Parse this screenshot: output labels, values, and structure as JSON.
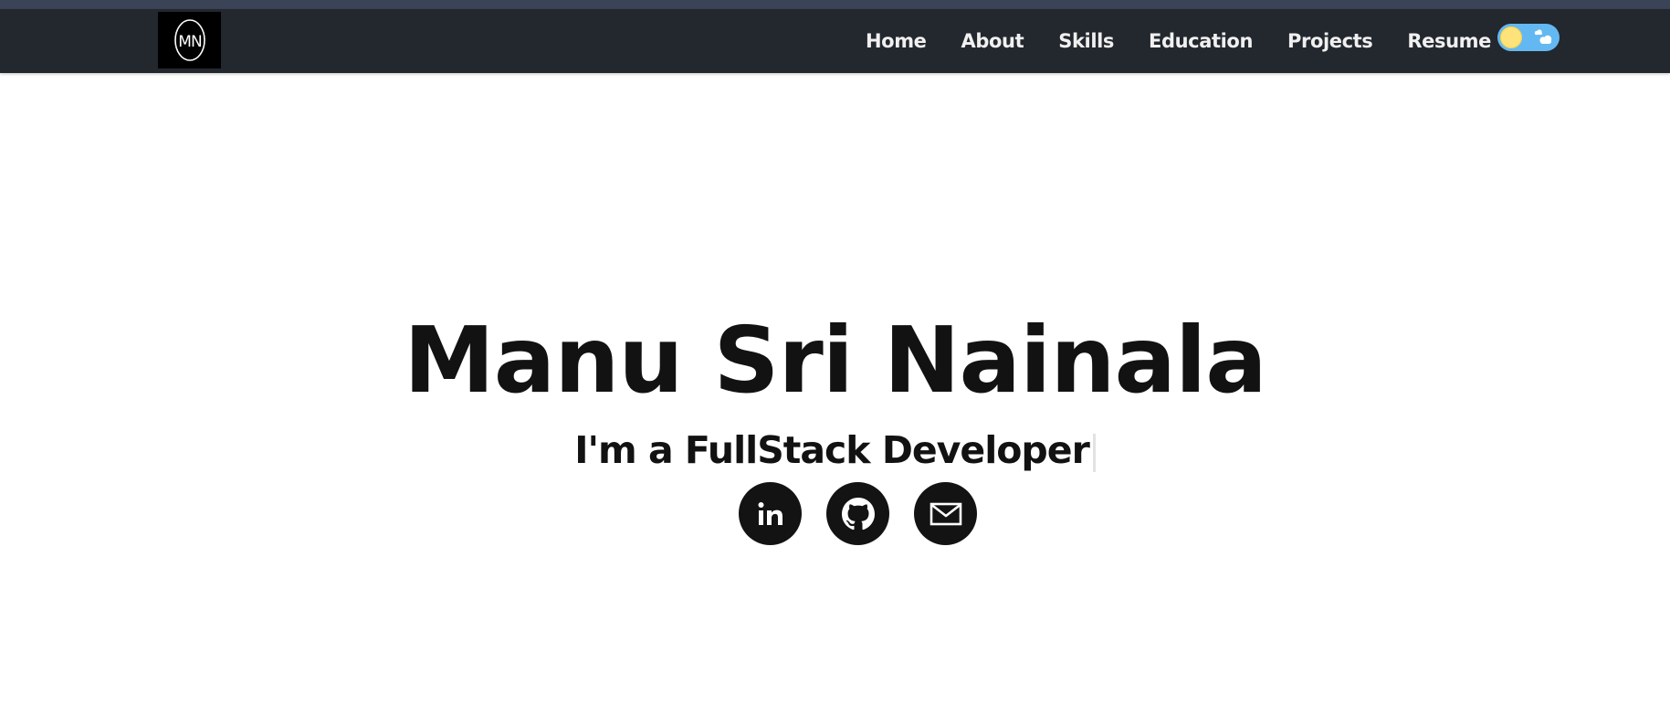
{
  "navbar": {
    "logo_text": "MN",
    "links": [
      "Home",
      "About",
      "Skills",
      "Education",
      "Projects",
      "Resume"
    ],
    "theme_toggle": {
      "state": "light",
      "icon": "sun-icon"
    }
  },
  "hero": {
    "name": "Manu Sri Nainala",
    "tagline": "I'm a FullStack Developer"
  },
  "socials": [
    {
      "icon": "linkedin-icon"
    },
    {
      "icon": "github-icon"
    },
    {
      "icon": "email-icon"
    }
  ],
  "colors": {
    "navbar_bg": "#23272e",
    "nav_text": "#f0f0f0",
    "hero_text": "#121212",
    "social_bg": "#131313",
    "toggle_bg": "#63b8f2",
    "sun": "#fde37a"
  }
}
